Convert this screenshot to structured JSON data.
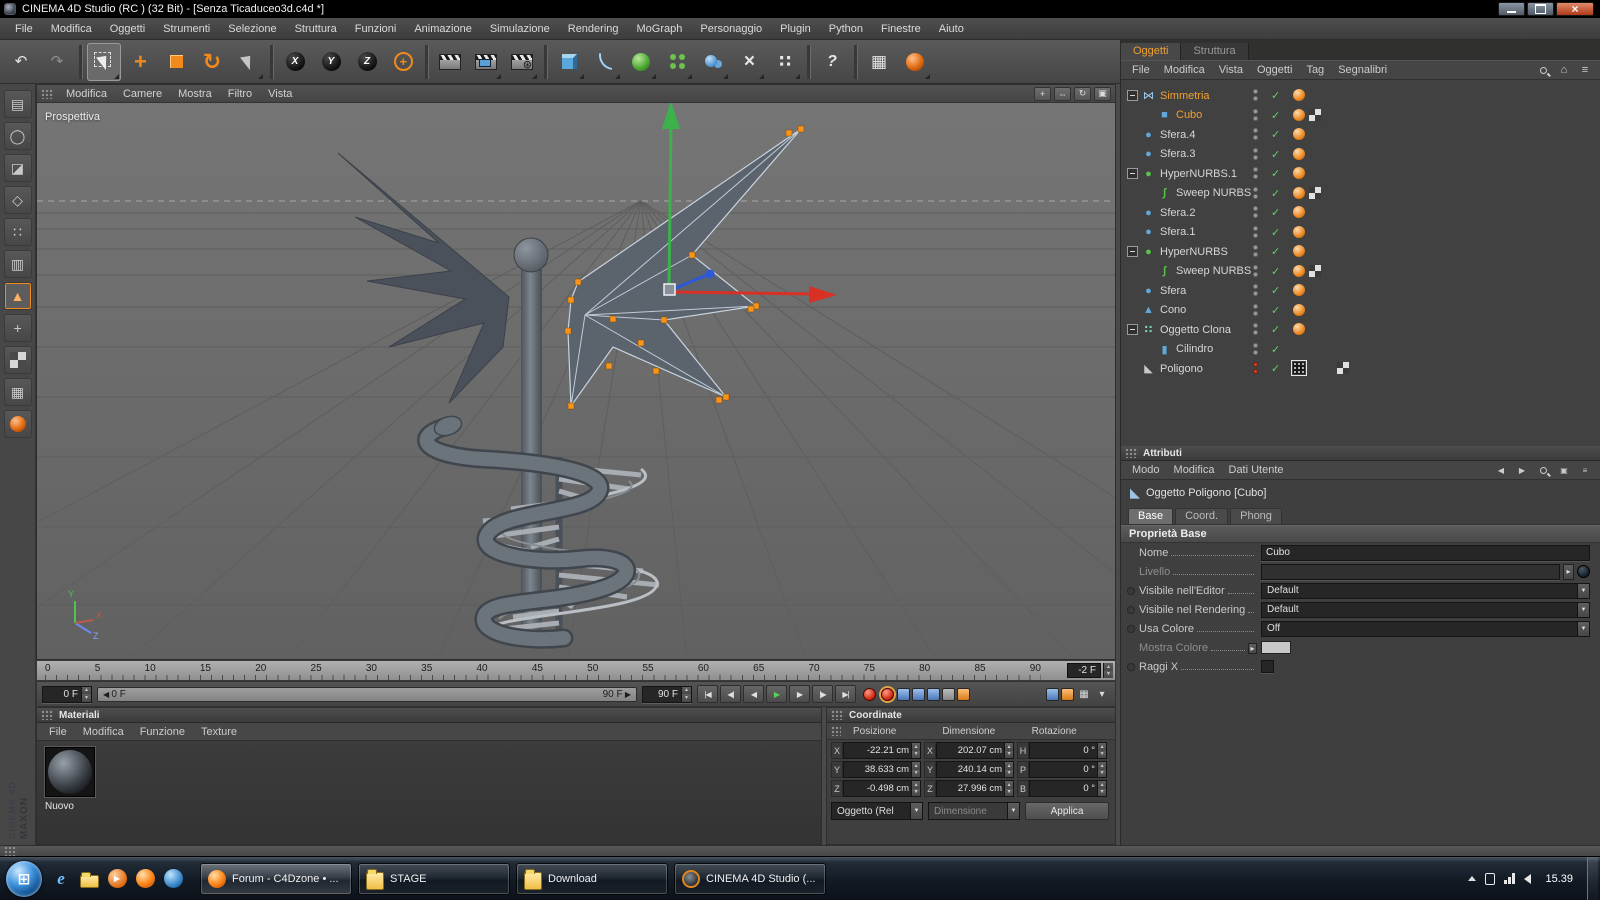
{
  "window": {
    "title": "CINEMA 4D Studio (RC ) (32 Bit) - [Senza Ticaduceo3d.c4d *]"
  },
  "menubar": {
    "items": [
      "File",
      "Modifica",
      "Oggetti",
      "Strumenti",
      "Selezione",
      "Struttura",
      "Funzioni",
      "Animazione",
      "Simulazione",
      "Rendering",
      "MoGraph",
      "Personaggio",
      "Plugin",
      "Python",
      "Finestre",
      "Aiuto"
    ]
  },
  "toolbar": {
    "items": [
      {
        "n": "undo-icon",
        "g": "↶"
      },
      {
        "n": "redo-icon",
        "g": "↷",
        "cls": "dim"
      },
      {
        "cls": "sep",
        "inter": "false"
      },
      {
        "n": "live-selection-tool",
        "cls": "active dd selbox",
        "shape": "cursor"
      },
      {
        "n": "move-tool",
        "g": "+",
        "cls": "orange xl"
      },
      {
        "n": "scale-tool",
        "shape": "sq"
      },
      {
        "n": "rotate-tool",
        "g": "↻",
        "cls": "orange xl"
      },
      {
        "n": "last-tool",
        "cls": "dd dim2",
        "shape": "cursor"
      },
      {
        "cls": "sep",
        "inter": "false"
      },
      {
        "n": "lock-x-icon",
        "g": "X",
        "shape": "ball"
      },
      {
        "n": "lock-y-icon",
        "g": "Y",
        "shape": "ball"
      },
      {
        "n": "lock-z-icon",
        "g": "Z",
        "shape": "ball"
      },
      {
        "n": "coordinate-system-icon",
        "g": "+",
        "cls": "ring orange"
      },
      {
        "cls": "sep",
        "inter": "false"
      },
      {
        "n": "render-view-icon",
        "shape": "clap"
      },
      {
        "n": "render-picture-viewer-icon",
        "shape": "clap pic",
        "cls": "dd"
      },
      {
        "n": "render-settings-icon",
        "shape": "clap gear",
        "cls": "dd"
      },
      {
        "cls": "sep",
        "inter": "false"
      },
      {
        "n": "add-cube-icon",
        "shape": "cube3d",
        "cls": "dd"
      },
      {
        "n": "spline-pen-icon",
        "shape": "spline",
        "cls": "dd"
      },
      {
        "n": "hypernurbs-icon",
        "shape": "greenball",
        "cls": "dd"
      },
      {
        "n": "mograph-icon",
        "shape": "greendots",
        "cls": "dd"
      },
      {
        "n": "metaball-icon",
        "shape": "blueballs",
        "cls": "dd"
      },
      {
        "n": "deformer-icon",
        "g": "×",
        "cls": "dd bigwhite"
      },
      {
        "n": "particles-icon",
        "g": "∷",
        "cls": "dd white lg"
      },
      {
        "cls": "sep",
        "inter": "false"
      },
      {
        "n": "help-icon",
        "g": "?",
        "cls": "help"
      },
      {
        "cls": "sep",
        "inter": "false"
      },
      {
        "n": "snap-settings-icon",
        "g": "▦",
        "cls": "white lg"
      },
      {
        "n": "paint-setup-icon",
        "shape": "paintball",
        "cls": "dd"
      }
    ]
  },
  "left_toolbar": {
    "items": [
      {
        "n": "make-editable-icon",
        "g": "▤"
      },
      {
        "n": "model-mode-icon",
        "g": "◯"
      },
      {
        "n": "texture-mode-icon",
        "g": "◪"
      },
      {
        "n": "workplane-icon",
        "g": "◇"
      },
      {
        "n": "points-mode-icon",
        "g": "∷"
      },
      {
        "n": "edges-mode-icon",
        "g": "▥"
      },
      {
        "n": "polygons-mode-icon",
        "g": "▲",
        "cls": "active"
      },
      {
        "n": "axis-mode-icon",
        "g": "+"
      },
      {
        "n": "checker-texture-icon",
        "shape": "chk"
      },
      {
        "n": "uv-mode-icon",
        "g": "▦"
      },
      {
        "n": "paint-mode-icon",
        "shape": "paintball"
      }
    ]
  },
  "viewport": {
    "menu": [
      "Modifica",
      "Camere",
      "Mostra",
      "Filtro",
      "Vista"
    ],
    "label": "Prospettiva",
    "axes": {
      "x": "X",
      "y": "Y",
      "z": "Z"
    },
    "view_icons": [
      {
        "n": "camera-move-icon",
        "g": "+"
      },
      {
        "n": "camera-zoom-icon",
        "g": "⇔"
      },
      {
        "n": "camera-rotate-icon",
        "g": "↻"
      },
      {
        "n": "toggle-layout-icon",
        "g": "▣"
      }
    ]
  },
  "timeline": {
    "ticks": [
      "0",
      "5",
      "10",
      "15",
      "20",
      "25",
      "30",
      "35",
      "40",
      "45",
      "50",
      "55",
      "60",
      "65",
      "70",
      "75",
      "80",
      "85",
      "90"
    ],
    "offset_field": "-2 F",
    "start_field": "0 F",
    "end_field": "90 F",
    "range_start": "0 F",
    "range_end": "90 F",
    "play_buttons": [
      {
        "n": "goto-start-button",
        "g": "|◀"
      },
      {
        "n": "prev-key-button",
        "g": "◀|"
      },
      {
        "n": "prev-frame-button",
        "g": "◀"
      },
      {
        "n": "play-button",
        "g": "▶",
        "cls": "green"
      },
      {
        "n": "next-frame-button",
        "g": "▶"
      },
      {
        "n": "next-key-button",
        "g": "|▶"
      },
      {
        "n": "goto-end-button",
        "g": "▶|"
      }
    ],
    "record_buttons": [
      {
        "n": "record-keyframe-button",
        "cls": "rec"
      },
      {
        "n": "autokey-button",
        "cls": "rec ring"
      },
      {
        "n": "record-position-toggle",
        "cls": "mini b"
      },
      {
        "n": "record-scale-toggle",
        "cls": "mini b"
      },
      {
        "n": "record-rotation-toggle",
        "cls": "mini b"
      },
      {
        "n": "record-parameter-toggle",
        "cls": "mini gr"
      },
      {
        "n": "record-pla-toggle",
        "cls": "mini o"
      }
    ],
    "right_icons": [
      {
        "n": "keyframe-selection-icon",
        "cls": "mini b"
      },
      {
        "n": "autokey-frame-icon",
        "cls": "mini o"
      },
      {
        "n": "grid-toggle-icon",
        "g": "▦"
      },
      {
        "n": "panel-menu-icon",
        "g": "▾"
      }
    ]
  },
  "materials": {
    "title": "Materiali",
    "menu": [
      "File",
      "Modifica",
      "Funzione",
      "Texture"
    ],
    "items": [
      {
        "name": "Nuovo"
      }
    ]
  },
  "coordinates": {
    "title": "Coordinate",
    "headers": [
      "Posizione",
      "Dimensione",
      "Rotazione"
    ],
    "rows": [
      {
        "pl": "X",
        "pv": "-22.21 cm",
        "dl": "X",
        "dv": "202.07 cm",
        "rl": "H",
        "rv": "0 °"
      },
      {
        "pl": "Y",
        "pv": "38.633 cm",
        "dl": "Y",
        "dv": "240.14 cm",
        "rl": "P",
        "rv": "0 °"
      },
      {
        "pl": "Z",
        "pv": "-0.498 cm",
        "dl": "Z",
        "dv": "27.996 cm",
        "rl": "B",
        "rv": "0 °"
      }
    ],
    "mode": "Oggetto (Rel",
    "size_mode": "Dimensione",
    "apply": "Applica"
  },
  "object_manager": {
    "tabs": [
      {
        "label": "Oggetti",
        "cls": "active"
      },
      {
        "label": "Struttura"
      }
    ],
    "menu": [
      "File",
      "Modifica",
      "Vista",
      "Oggetti",
      "Tag",
      "Segnalibri"
    ],
    "header_icons": [
      {
        "n": "search-icon",
        "cls": "mag"
      },
      {
        "n": "home-icon",
        "g": "⌂"
      },
      {
        "n": "panel-menu-icon",
        "g": "≡"
      }
    ],
    "items": [
      {
        "name": "Simmetria",
        "d": "d0",
        "exp": "on",
        "sel": "sel",
        "icon": "i-sym",
        "icon_name": "symmetry-icon",
        "t1": "tag-dot"
      },
      {
        "name": "Cubo",
        "d": "d1",
        "sel": "sel",
        "icon": "i-cube",
        "icon_name": "cube-icon",
        "t1": "tag-dot",
        "t2": "tag-checker"
      },
      {
        "name": "Sfera.4",
        "d": "d0",
        "icon": "i-sphere",
        "icon_name": "sphere-icon",
        "t1": "tag-dot"
      },
      {
        "name": "Sfera.3",
        "d": "d0",
        "icon": "i-sphere",
        "icon_name": "sphere-icon",
        "t1": "tag-dot"
      },
      {
        "name": "HyperNURBS.1",
        "d": "d0",
        "exp": "on",
        "icon": "i-hn",
        "icon_name": "hypernurbs-icon",
        "t1": "tag-dot"
      },
      {
        "name": "Sweep NURBS",
        "d": "d1",
        "icon": "i-sweep",
        "icon_name": "sweep-nurbs-icon",
        "t1": "tag-dot",
        "t2": "tag-checker"
      },
      {
        "name": "Sfera.2",
        "d": "d0",
        "icon": "i-sphere",
        "icon_name": "sphere-icon",
        "t1": "tag-dot"
      },
      {
        "name": "Sfera.1",
        "d": "d0",
        "icon": "i-sphere",
        "icon_name": "sphere-icon",
        "t1": "tag-dot"
      },
      {
        "name": "HyperNURBS",
        "d": "d0",
        "exp": "on",
        "icon": "i-hn",
        "icon_name": "hypernurbs-icon",
        "t1": "tag-dot"
      },
      {
        "name": "Sweep NURBS",
        "d": "d1",
        "icon": "i-sweep",
        "icon_name": "sweep-nurbs-icon",
        "t1": "tag-dot",
        "t2": "tag-checker"
      },
      {
        "name": "Sfera",
        "d": "d0",
        "icon": "i-sphere",
        "icon_name": "sphere-icon",
        "t1": "tag-dot"
      },
      {
        "name": "Cono",
        "d": "d0",
        "icon": "i-cone",
        "icon_name": "cone-icon",
        "t1": "tag-dot"
      },
      {
        "name": "Oggetto Clona",
        "d": "d0",
        "exp": "on",
        "icon": "i-cloner",
        "icon_name": "cloner-icon",
        "t1": "tag-dot"
      },
      {
        "name": "Cilindro",
        "d": "d1",
        "icon": "i-cyl",
        "icon_name": "cylinder-icon"
      },
      {
        "name": "Poligono",
        "d": "d0",
        "icon": "i-poly",
        "icon_name": "polygon-icon",
        "dots": "red",
        "t1": "tag-poly",
        "t3": "tag-checker"
      }
    ]
  },
  "attributes": {
    "title": "Attributi",
    "menu": [
      "Modo",
      "Modifica",
      "Dati Utente"
    ],
    "menu_icons": [
      {
        "n": "back-icon",
        "g": "◀"
      },
      {
        "n": "forward-icon",
        "g": "▶"
      },
      {
        "n": "search-icon",
        "cls": "mag"
      },
      {
        "n": "lock-icon",
        "g": "▣"
      },
      {
        "n": "menu-icon",
        "g": "≡"
      }
    ],
    "object_label": "Oggetto Poligono [Cubo]",
    "tabs": [
      {
        "label": "Base",
        "cls": "active"
      },
      {
        "label": "Coord."
      },
      {
        "label": "Phong"
      }
    ],
    "section": "Proprietà Base",
    "fields": {
      "nome": {
        "label": "Nome",
        "value": "Cubo"
      },
      "livello": {
        "label": "Livello"
      },
      "vis_editor": {
        "label": "Visibile nell'Editor",
        "value": "Default"
      },
      "vis_render": {
        "label": "Visibile nel Rendering",
        "value": "Default"
      },
      "usa_colore": {
        "label": "Usa Colore",
        "value": "Off"
      },
      "mostra_colore": {
        "label": "Mostra Colore"
      },
      "raggi_x": {
        "label": "Raggi X"
      }
    }
  },
  "taskbar": {
    "quick_icons": [
      {
        "n": "internet-explorer-icon",
        "cls": "qi-ie"
      },
      {
        "n": "explorer-folder-icon",
        "cls": "qi-folder"
      },
      {
        "n": "media-player-icon",
        "cls": "qi-media"
      },
      {
        "n": "firefox-icon",
        "cls": "qi-ff"
      },
      {
        "n": "app-blue-icon",
        "cls": "qi-blue"
      }
    ],
    "buttons": [
      {
        "label": "Forum - C4Dzone • ...",
        "icon": "qi-ff",
        "cls": "active"
      },
      {
        "label": "STAGE",
        "icon": "qi-folder"
      },
      {
        "label": "Download",
        "icon": "qi-folder"
      },
      {
        "label": "CINEMA 4D Studio (...",
        "icon": "qi-c4d"
      }
    ],
    "time": "15.39"
  },
  "branding": {
    "line1": "MAXON",
    "line2": "CINEMA 4D"
  }
}
